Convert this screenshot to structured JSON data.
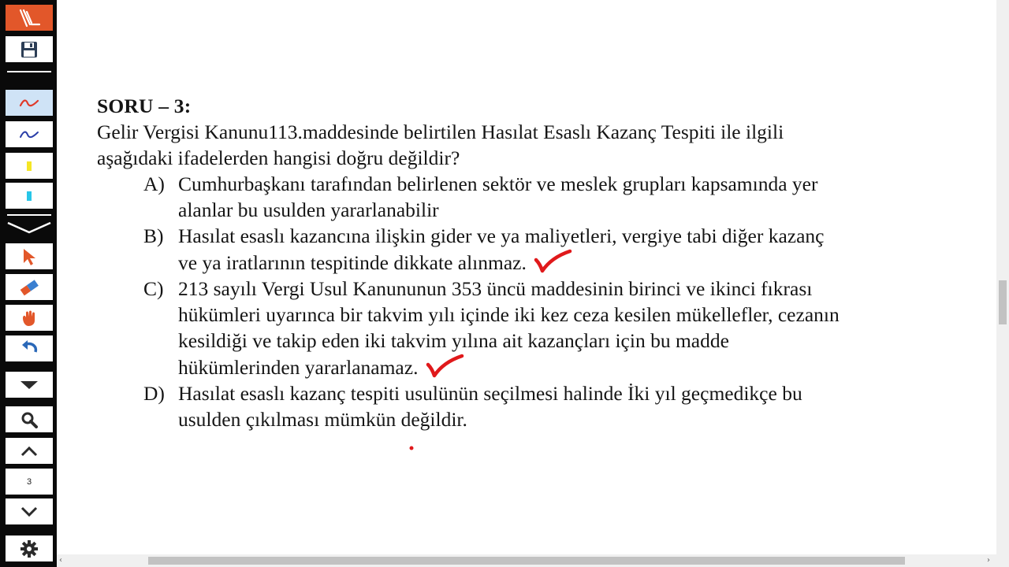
{
  "toolbar": {
    "page_number": "3",
    "tools": [
      {
        "icon": "pen-logo-icon"
      },
      {
        "icon": "save-icon"
      },
      {
        "icon": "red-pen-icon",
        "color": "#e03a2a"
      },
      {
        "icon": "blue-pen-icon",
        "color": "#2a3ea8"
      },
      {
        "icon": "yellow-highlighter-icon",
        "color": "#f5e625"
      },
      {
        "icon": "cyan-highlighter-icon",
        "color": "#27c6e8"
      },
      {
        "icon": "collapse-chevron-icon"
      },
      {
        "icon": "pointer-arrow-icon"
      },
      {
        "icon": "eraser-icon"
      },
      {
        "icon": "hand-icon"
      },
      {
        "icon": "undo-icon"
      },
      {
        "icon": "dropdown-icon"
      },
      {
        "icon": "search-icon"
      },
      {
        "icon": "page-up-icon"
      },
      {
        "icon": "page-down-icon"
      },
      {
        "icon": "gear-icon"
      }
    ]
  },
  "question": {
    "title": "SORU – 3:",
    "stem_line1": "Gelir Vergisi Kanunu113.maddesinde belirtilen Hasılat Esaslı Kazanç Tespiti ile ilgili",
    "stem_line2": "aşağıdaki ifadelerden hangisi doğru değildir?",
    "options": [
      {
        "letter": "A)",
        "lines": [
          "Cumhurbaşkanı tarafından belirlenen sektör ve meslek grupları kapsamında yer",
          "alanlar bu usulden yararlanabilir"
        ]
      },
      {
        "letter": "B)",
        "lines": [
          "Hasılat esaslı kazancına ilişkin gider ve ya maliyetleri, vergiye tabi diğer kazanç",
          "ve ya iratlarının tespitinde dikkate alınmaz."
        ]
      },
      {
        "letter": "C)",
        "lines": [
          "213 sayılı Vergi Usul Kanununun 353 üncü maddesinin birinci ve ikinci fıkrası",
          "hükümleri uyarınca bir takvim yılı içinde iki kez ceza kesilen mükellefler, cezanın",
          "kesildiği ve takip eden iki takvim yılına ait kazançları için bu madde",
          "hükümlerinden yararlanamaz."
        ]
      },
      {
        "letter": "D)",
        "lines": [
          "Hasılat esaslı kazanç tespiti usulünün seçilmesi halinde İki yıl geçmedikçe bu",
          "usulden çıkılması mümkün değildir."
        ]
      }
    ]
  },
  "colors": {
    "toolbar_bg": "#0a0a0a",
    "accent_orange": "#e2572a",
    "annotation_red": "#e0191b"
  }
}
